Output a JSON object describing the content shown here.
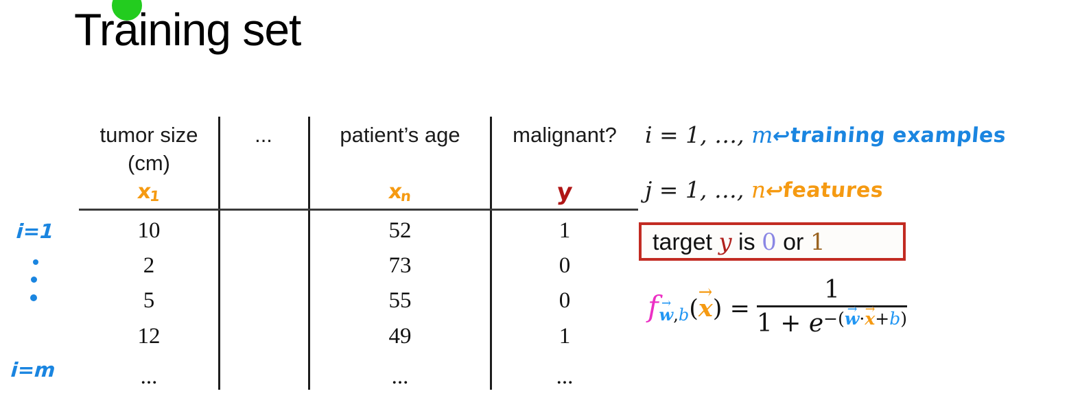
{
  "slide": {
    "title": "Training set",
    "bullet_color": "#23cc1f"
  },
  "table": {
    "headers": [
      {
        "label": "tumor size\n(cm)",
        "symbol": "x",
        "symbol_sub": "1",
        "symbol_color": "#f59a12"
      },
      {
        "label": "...",
        "symbol": "",
        "symbol_sub": "",
        "symbol_color": ""
      },
      {
        "label": "patient’s age",
        "symbol": "x",
        "symbol_sub": "n",
        "symbol_color": "#f59a12"
      },
      {
        "label": "malignant?",
        "symbol": "y",
        "symbol_sub": "",
        "symbol_color": "#b01616"
      }
    ],
    "rows": [
      {
        "tumor_size": "10",
        "middle": "",
        "age": "52",
        "y": "1"
      },
      {
        "tumor_size": "2",
        "middle": "",
        "age": "73",
        "y": "0"
      },
      {
        "tumor_size": "5",
        "middle": "",
        "age": "55",
        "y": "0"
      },
      {
        "tumor_size": "12",
        "middle": "",
        "age": "49",
        "y": "1"
      },
      {
        "tumor_size": "...",
        "middle": "",
        "age": "...",
        "y": "..."
      }
    ],
    "row_index_first": "i=1",
    "row_index_last": "i=m",
    "row_index_color": "#1a85e0"
  },
  "annotations": {
    "index_i": {
      "prefix": "i = 1, …, ",
      "var": "m",
      "var_color": "#1a85e0",
      "arrow": "↩",
      "note": "training examples",
      "note_color": "#1a85e0"
    },
    "index_j": {
      "prefix": "j = 1, …, ",
      "var": "n",
      "var_color": "#f59a12",
      "arrow": "↩",
      "note": "features",
      "note_color": "#f59a12"
    },
    "target_box": {
      "lead": "target ",
      "y": "y",
      "y_color": "#b0201c",
      "mid": " is ",
      "zero": "0",
      "zero_color": "#8a86e4",
      "or": " or ",
      "one": "1",
      "one_color": "#9a6320",
      "border_color": "#c22b22"
    },
    "formula": {
      "f": "f",
      "f_color": "#ec2fc4",
      "sub_w": "w",
      "sub_comma": ",",
      "sub_b": "b",
      "arg_open": "(",
      "arg_x": "x",
      "arg_close": ")",
      "equals": "=",
      "numerator": "1",
      "den_prefix": "1 + ",
      "den_e": "e",
      "exp_minus": "−(",
      "exp_w": "w",
      "exp_dot": "·",
      "exp_x": "x",
      "exp_plus": "+",
      "exp_b": "b",
      "exp_close": ")",
      "vector_blue": "#2196f3",
      "vector_orange": "#f59a12"
    }
  }
}
